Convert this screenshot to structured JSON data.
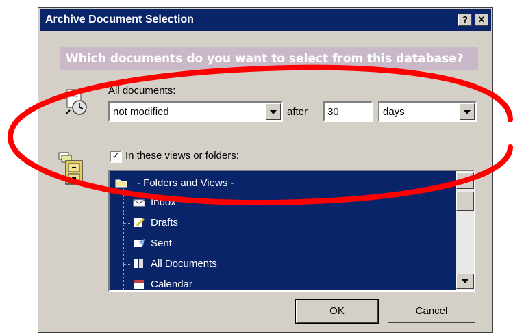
{
  "window": {
    "title": "Archive Document Selection",
    "help_label": "?",
    "close_label": "✕"
  },
  "banner": {
    "text": "Which documents do you want to select from this database?"
  },
  "criteria": {
    "all_documents_label": "All documents:",
    "condition_value": "not modified",
    "after_label": "after",
    "count_value": "30",
    "unit_value": "days"
  },
  "views": {
    "checkbox_checked": true,
    "checkbox_mark": "✓",
    "checkbox_label": "In these views or folders:",
    "items": [
      {
        "label": "- Folders and Views -",
        "icon": "folder-icon"
      },
      {
        "label": "Inbox",
        "icon": "inbox-icon"
      },
      {
        "label": "Drafts",
        "icon": "drafts-icon"
      },
      {
        "label": "Sent",
        "icon": "sent-icon"
      },
      {
        "label": "All Documents",
        "icon": "all-documents-icon"
      },
      {
        "label": "Calendar",
        "icon": "calendar-icon"
      }
    ]
  },
  "buttons": {
    "ok_label": "OK",
    "cancel_label": "Cancel"
  },
  "colors": {
    "title_bar": "#0a246a",
    "selection": "#0a246a",
    "banner": "#c8b8c8",
    "annotation": "#ff0000",
    "dialog_face": "#d4d0c8"
  }
}
